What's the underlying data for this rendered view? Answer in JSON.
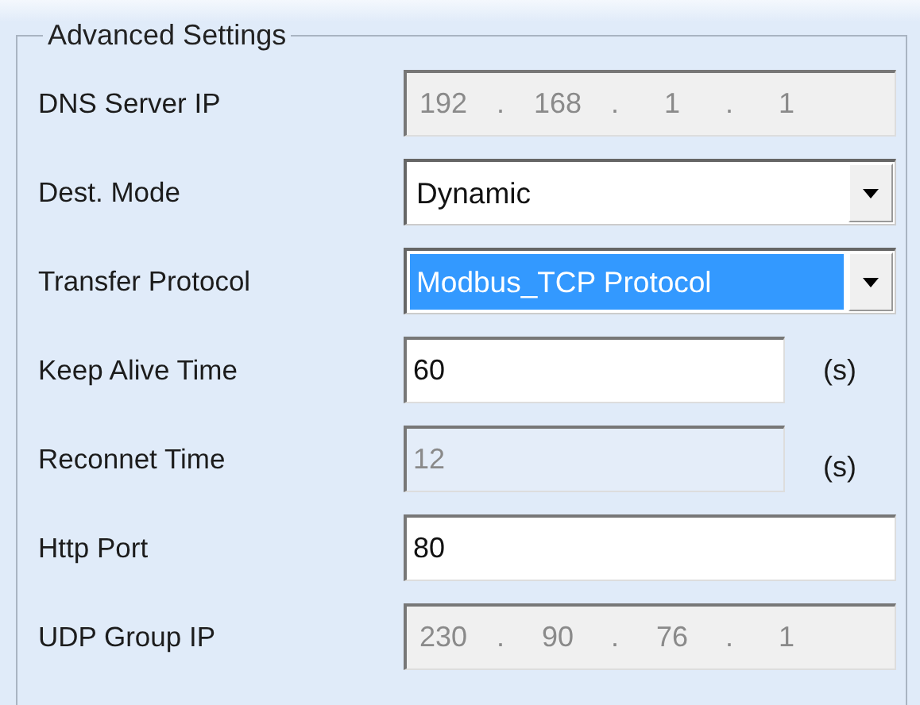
{
  "group": {
    "title": "Advanced Settings"
  },
  "rows": [
    {
      "kind": "ip",
      "label": "DNS Server IP",
      "octets": [
        "192",
        "168",
        "1",
        "1"
      ],
      "separator": ".",
      "disabled": true
    },
    {
      "kind": "select",
      "label": "Dest. Mode",
      "value": "Dynamic",
      "highlighted": false
    },
    {
      "kind": "select",
      "label": "Transfer Protocol",
      "value": "Modbus_TCP Protocol",
      "highlighted": true
    },
    {
      "kind": "text",
      "label": "Keep Alive Time",
      "value": "60",
      "unit": "(s)",
      "disabled": false
    },
    {
      "kind": "text",
      "label": "Reconnet Time",
      "value": "12",
      "unit": "(s)",
      "disabled": true
    },
    {
      "kind": "text",
      "label": "Http Port",
      "value": "80",
      "disabled": false
    },
    {
      "kind": "ip",
      "label": "UDP Group IP",
      "octets": [
        "230",
        "90",
        "76",
        "1"
      ],
      "separator": ".",
      "disabled": true
    }
  ]
}
